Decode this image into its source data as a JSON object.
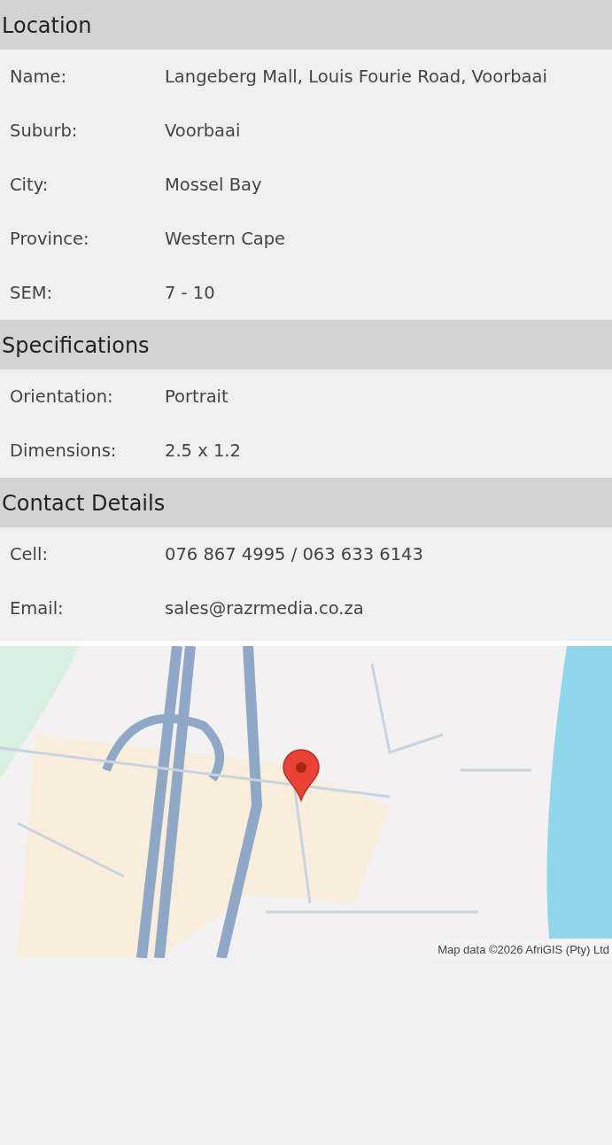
{
  "sections": [
    {
      "title": "Location",
      "rows": [
        {
          "label": "Name:",
          "value": "Langeberg Mall, Louis Fourie Road, Voorbaai"
        },
        {
          "label": "Suburb:",
          "value": "Voorbaai"
        },
        {
          "label": "City:",
          "value": "Mossel Bay"
        },
        {
          "label": "Province:",
          "value": "Western Cape"
        },
        {
          "label": "SEM:",
          "value": "7 - 10"
        }
      ]
    },
    {
      "title": "Specifications",
      "rows": [
        {
          "label": "Orientation:",
          "value": "Portrait"
        },
        {
          "label": "Dimensions:",
          "value": "2.5 x 1.2"
        }
      ]
    },
    {
      "title": "Contact Details",
      "rows": [
        {
          "label": "Cell:",
          "value": "076 867 4995 / 063 633 6143"
        },
        {
          "label": "Email:",
          "value": "sales@razrmedia.co.za"
        }
      ]
    }
  ],
  "map": {
    "attribution": "Map data ©2026 AfriGIS (Pty) Ltd"
  }
}
